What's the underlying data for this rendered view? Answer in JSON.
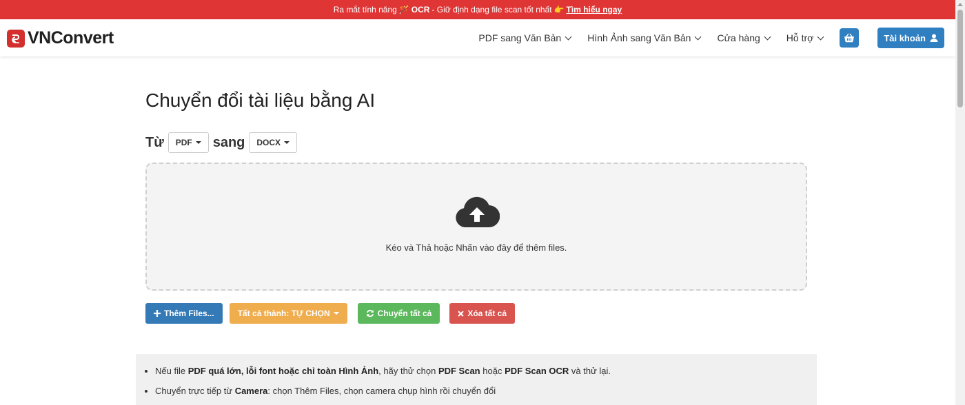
{
  "announcement": {
    "prefix": "Ra mắt tính năng",
    "feature": "OCR",
    "middle": "- Giữ định dạng file scan tốt nhất",
    "link": "Tìm hiểu ngay"
  },
  "brand": {
    "name": "VNConvert"
  },
  "nav": {
    "items": [
      {
        "label": "PDF sang Văn Bản"
      },
      {
        "label": "Hình Ảnh sang Văn Bản"
      },
      {
        "label": "Cửa hàng"
      },
      {
        "label": "Hỗ trợ"
      }
    ],
    "account_label": "Tài khoản"
  },
  "main": {
    "title": "Chuyển đổi tài liệu bằng AI",
    "from_label": "Từ",
    "from_value": "PDF",
    "to_label": "sang",
    "to_value": "DOCX",
    "drop_text": "Kéo và Thả hoặc Nhấn vào đây để thêm files."
  },
  "actions": {
    "add_files": "Thêm Files...",
    "convert_all_to": "Tất cả thành: TỰ CHỌN",
    "convert_all": "Chuyển tất cả",
    "delete_all": "Xóa tất cả"
  },
  "tips": {
    "tip1": {
      "t1": "Nếu file",
      "b1": "PDF quá lớn, lỗi font hoặc chỉ toàn Hình Ảnh",
      "t2": ", hãy thử chọn",
      "b2": "PDF Scan",
      "t3": "hoặc",
      "b3": "PDF Scan OCR",
      "t4": "và thử lại."
    },
    "tip2": {
      "t1": "Chuyển trực tiếp từ",
      "b1": "Camera",
      "t2": ": chọn Thêm Files, chọn camera chụp hình rồi chuyển đổi"
    }
  },
  "colors": {
    "announce_bg": "#e03535",
    "primary": "#337ab7",
    "warning": "#f0ad4e",
    "success": "#5cb85c",
    "danger": "#d9534f"
  }
}
